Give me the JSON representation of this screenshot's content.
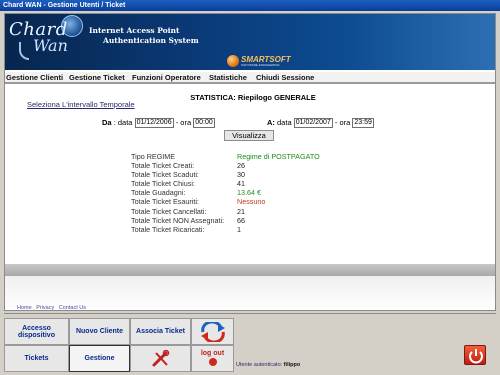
{
  "window": {
    "title": "Chard WAN - Gestione Utenti / Ticket"
  },
  "banner": {
    "logo_line1": "Chard",
    "logo_line2": "Wan",
    "tagline_1": "Internet Access Point",
    "tagline_2": "Authentication System",
    "brand": "SMARTSOFT",
    "brand_sub": "SOFTWARE ENGINEERING",
    "icons": [
      "globe-icon",
      "satellite-dish-icon"
    ]
  },
  "menu": [
    {
      "label": "Gestione Clienti"
    },
    {
      "label": "Gestione Ticket"
    },
    {
      "label": "Funzioni Operatore"
    },
    {
      "label": "Statistiche"
    },
    {
      "label": "Chiudi Sessione"
    }
  ],
  "page": {
    "range_link": "Seleziona L'intervallo Temporale",
    "title": "STATISTICA: Riepilogo GENERALE"
  },
  "range": {
    "from_label": "Da",
    "data_label": "data",
    "from_date": "01/12/2006",
    "ora_label": "ora",
    "from_time": "00:00",
    "to_label": "A:",
    "to_date": "01/02/2007",
    "to_time": "23:59",
    "button": "Visualizza"
  },
  "stats": [
    {
      "label": "Tipo REGIME",
      "value": "Regime di POSTPAGATO",
      "tone": "green"
    },
    {
      "label": "Totale Ticket Creati:",
      "value": "26",
      "tone": ""
    },
    {
      "label": "Totale Ticket Scaduti:",
      "value": "30",
      "tone": ""
    },
    {
      "label": "Totale Ticket Chiusi:",
      "value": "41",
      "tone": ""
    },
    {
      "label": "Totale Guadagni:",
      "value": "13.64 €",
      "tone": "green"
    },
    {
      "label": "Totale Ticket Esauriti:",
      "value": "Nessuno",
      "tone": "red"
    },
    {
      "label": "Totale Ticket Cancellati:",
      "value": "21",
      "tone": ""
    },
    {
      "label": "Totale Ticket NON Assegnati:",
      "value": "66",
      "tone": ""
    },
    {
      "label": "Totale Ticket Ricaricati:",
      "value": "1",
      "tone": ""
    }
  ],
  "footer_links": [
    "Home",
    "Privacy",
    "Contact Us"
  ],
  "nav": {
    "accesso": "Accesso dispositivo",
    "nuovo": "Nuovo Cliente",
    "associa": "Associa Ticket",
    "tickets": "Tickets",
    "gestione": "Gestione",
    "logout": "log out",
    "tools_icon": "tools-icon",
    "refresh_icon": "refresh-arrows-icon",
    "power_icon": "power-icon"
  },
  "status": {
    "label": "Utente autenticato:",
    "user": "filippo"
  },
  "colors": {
    "titlebar": "#0a3d9a",
    "banner": "#0b3a78",
    "accent_green": "#1e8a1e",
    "accent_red": "#c23a1e",
    "nav_text": "#0a2a8a",
    "power_button": "#c11c10"
  }
}
